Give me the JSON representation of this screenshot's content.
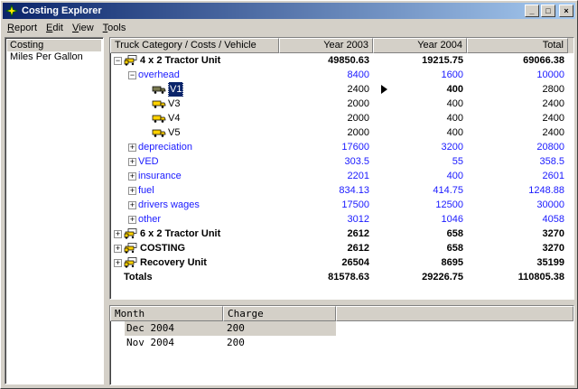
{
  "window": {
    "title": "Costing Explorer",
    "controls": [
      "_",
      "□",
      "×"
    ]
  },
  "menu": [
    {
      "label": "Report",
      "mnemonic": "R"
    },
    {
      "label": "Edit",
      "mnemonic": "E"
    },
    {
      "label": "View",
      "mnemonic": "V"
    },
    {
      "label": "Tools",
      "mnemonic": "T"
    }
  ],
  "nav": {
    "items": [
      "Costing",
      "Miles Per Gallon"
    ],
    "selected": "Costing"
  },
  "grid": {
    "columns": [
      "Truck Category / Costs / Vehicle",
      "Year 2003",
      "Year 2004",
      "Total"
    ],
    "rows": [
      {
        "label": "4 x 2 Tractor Unit",
        "v": [
          "49850.63",
          "19215.75",
          "69066.38"
        ],
        "level": 0,
        "exp": "−",
        "icon": "truck-group-icon",
        "style": "bold"
      },
      {
        "label": "overhead",
        "v": [
          "8400",
          "1600",
          "10000"
        ],
        "level": 1,
        "exp": "−",
        "style": "blue"
      },
      {
        "label": "V1",
        "v": [
          "2400",
          "400",
          "2800"
        ],
        "level": 2,
        "icon": "truck-selected-icon",
        "style": "plain",
        "selected": true
      },
      {
        "label": "V3",
        "v": [
          "2000",
          "400",
          "2400"
        ],
        "level": 2,
        "icon": "truck-icon",
        "style": "plain"
      },
      {
        "label": "V4",
        "v": [
          "2000",
          "400",
          "2400"
        ],
        "level": 2,
        "icon": "truck-icon",
        "style": "plain"
      },
      {
        "label": "V5",
        "v": [
          "2000",
          "400",
          "2400"
        ],
        "level": 2,
        "icon": "truck-icon",
        "style": "plain"
      },
      {
        "label": "depreciation",
        "v": [
          "17600",
          "3200",
          "20800"
        ],
        "level": 1,
        "exp": "+",
        "style": "blue"
      },
      {
        "label": "VED",
        "v": [
          "303.5",
          "55",
          "358.5"
        ],
        "level": 1,
        "exp": "+",
        "style": "blue"
      },
      {
        "label": "insurance",
        "v": [
          "2201",
          "400",
          "2601"
        ],
        "level": 1,
        "exp": "+",
        "style": "blue"
      },
      {
        "label": "fuel",
        "v": [
          "834.13",
          "414.75",
          "1248.88"
        ],
        "level": 1,
        "exp": "+",
        "style": "blue"
      },
      {
        "label": "drivers wages",
        "v": [
          "17500",
          "12500",
          "30000"
        ],
        "level": 1,
        "exp": "+",
        "style": "blue"
      },
      {
        "label": "other",
        "v": [
          "3012",
          "1046",
          "4058"
        ],
        "level": 1,
        "exp": "+",
        "style": "blue"
      },
      {
        "label": "6 x 2 Tractor Unit",
        "v": [
          "2612",
          "658",
          "3270"
        ],
        "level": 0,
        "exp": "+",
        "icon": "truck-group-icon",
        "style": "bold"
      },
      {
        "label": "COSTING",
        "v": [
          "2612",
          "658",
          "3270"
        ],
        "level": 0,
        "exp": "+",
        "icon": "truck-group-icon",
        "style": "bold"
      },
      {
        "label": "Recovery Unit",
        "v": [
          "26504",
          "8695",
          "35199"
        ],
        "level": 0,
        "exp": "+",
        "icon": "truck-group-icon",
        "style": "bold"
      },
      {
        "label": "Totals",
        "v": [
          "81578.63",
          "29226.75",
          "110805.38"
        ],
        "level": 0,
        "style": "bold"
      }
    ],
    "bold_value_row": 2,
    "bold_value_col": 1
  },
  "charges": {
    "columns": [
      "Month",
      "Charge"
    ],
    "rows": [
      {
        "month": "Dec 2004",
        "charge": "200",
        "selected": true
      },
      {
        "month": "Nov 2004",
        "charge": "200",
        "selected": false
      }
    ]
  },
  "colors": {
    "cost_item_text": "#1a1aff",
    "title_gradient_start": "#0a246a",
    "title_gradient_end": "#a6caf0",
    "truck_yellow": "#ffd200"
  }
}
